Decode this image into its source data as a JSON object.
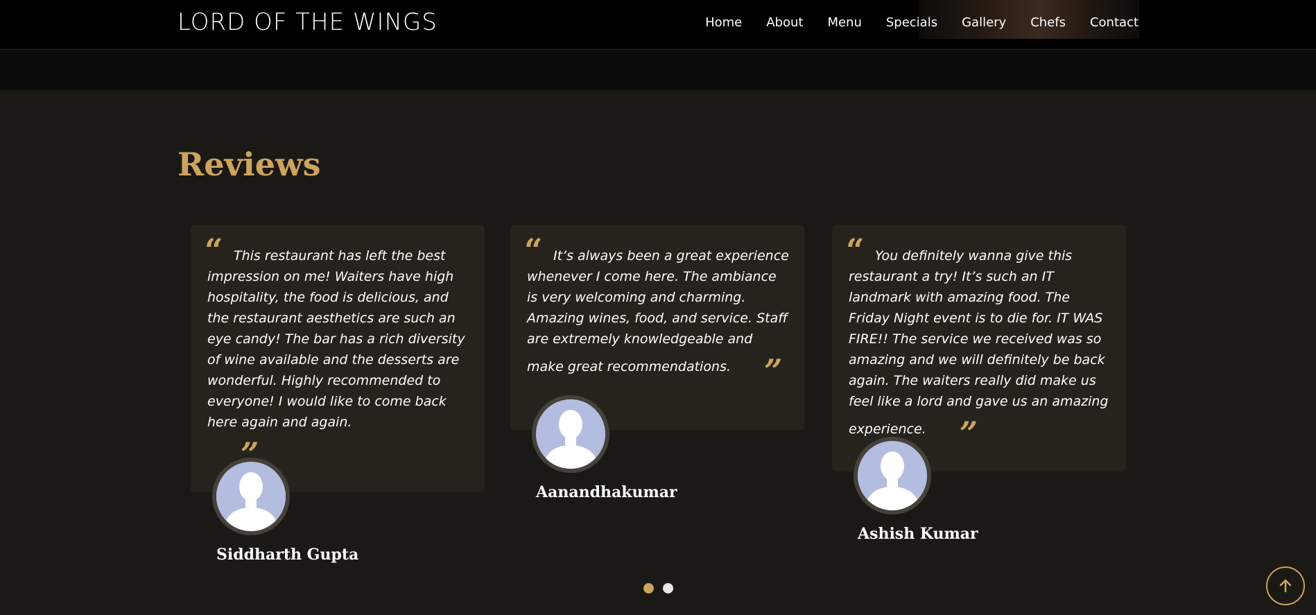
{
  "navbar": {
    "logo": "LORD OF THE WINGS",
    "links": [
      "Home",
      "About",
      "Menu",
      "Specials",
      "Gallery",
      "Chefs",
      "Contact"
    ]
  },
  "reviews_section": {
    "title": "Reviews",
    "reviews": [
      {
        "text": "This restaurant has left the best impression on me! Waiters have high hospitality, the food is delicious, and the restaurant aesthetics are such an eye candy! The bar has a rich diversity of wine available and the desserts are wonderful. Highly recommended to everyone! I would like to come back here again and again.",
        "name": "Siddharth Gupta"
      },
      {
        "text": "It’s always been a great experience whenever I come here. The ambiance is very welcoming and charming. Amazing wines, food, and service. Staff are extremely knowledgeable and make great recommendations.",
        "name": "Aanandhakumar"
      },
      {
        "text": "You definitely wanna give this restaurant a try! It’s such an IT landmark with amazing food. The Friday Night event is to die for. IT WAS FIRE!! The service we received was so amazing and we will definitely be back again. The waiters really did make us feel like a lord and gave us an amazing experience.",
        "name": "Ashish Kumar"
      }
    ],
    "pagination": {
      "page_count": 2,
      "active_index": 0
    }
  },
  "icons": {
    "quote_open": "quote-open-icon",
    "quote_close": "quote-close-icon",
    "avatar": "person-silhouette-icon",
    "back_to_top": "arrow-up-icon"
  },
  "colors": {
    "accent": "#cda45e",
    "background": "#1b1915",
    "card": "#26231d",
    "navbar": "#000000",
    "avatar_bg": "#b2bddf",
    "dot_inactive": "#e6e6e6"
  }
}
